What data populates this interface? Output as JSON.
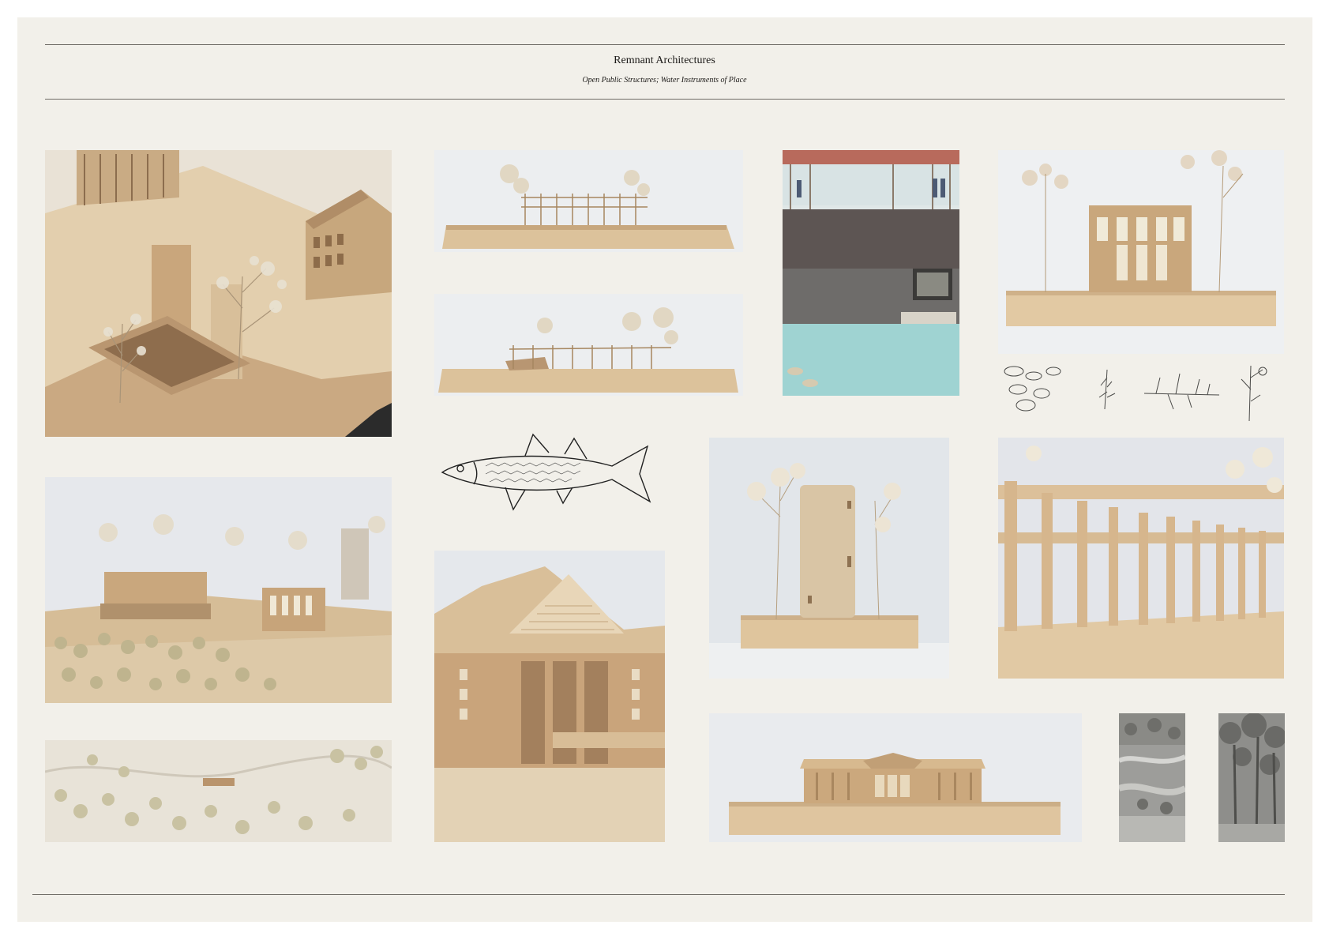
{
  "header": {
    "title": "Remnant Architectures",
    "subtitle": "Open Public Structures; Water Instruments of Place"
  },
  "colors": {
    "paper": "#f2f0ea",
    "rule": "#6f6c66",
    "wood": "#d9c3a0",
    "wood_dark": "#a88a64",
    "backdrop": "#e4e6ea",
    "water": "#9fd3d2",
    "brick": "#5d5553",
    "roof_red": "#b86a5c"
  },
  "panels": [
    {
      "name": "model-aerial-plinth-photo",
      "icon": "architectural-model-photo"
    },
    {
      "name": "model-fence-elevation-photo-1",
      "icon": "architectural-model-photo"
    },
    {
      "name": "model-fence-elevation-photo-2",
      "icon": "architectural-model-photo"
    },
    {
      "name": "water-section-drawing",
      "icon": "section-illustration"
    },
    {
      "name": "model-pavilion-front-photo",
      "icon": "architectural-model-photo"
    },
    {
      "name": "botanical-sketches",
      "icon": "plant-sketch-icons"
    },
    {
      "name": "model-site-overview-photo",
      "icon": "architectural-model-photo"
    },
    {
      "name": "fish-engraving",
      "icon": "fish-icon"
    },
    {
      "name": "model-tower-photo",
      "icon": "architectural-model-photo"
    },
    {
      "name": "model-colonnade-photo",
      "icon": "architectural-model-photo"
    },
    {
      "name": "model-gabled-hall-closeup-photo",
      "icon": "architectural-model-photo"
    },
    {
      "name": "model-site-topography-photo",
      "icon": "architectural-model-photo"
    },
    {
      "name": "model-long-hall-elevation-photo",
      "icon": "architectural-model-photo"
    },
    {
      "name": "wetland-photo",
      "icon": "landscape-photo"
    },
    {
      "name": "woodland-photo",
      "icon": "landscape-photo"
    }
  ]
}
